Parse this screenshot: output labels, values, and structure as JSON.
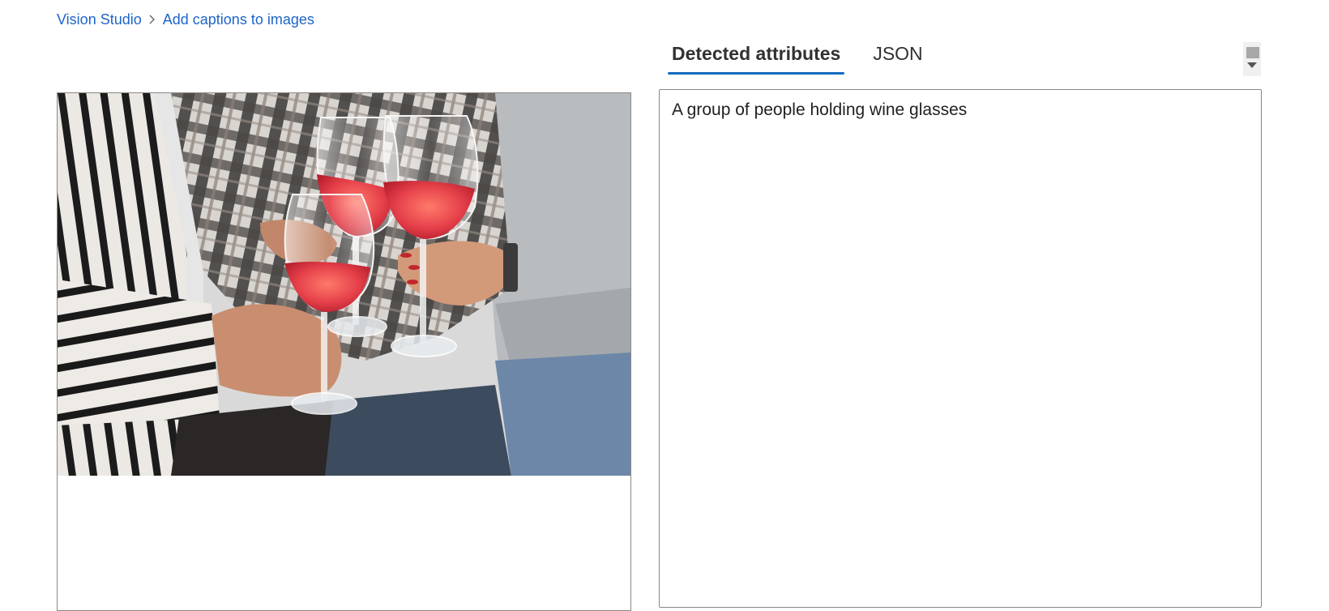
{
  "breadcrumb": {
    "items": [
      {
        "label": "Vision Studio"
      },
      {
        "label": "Add captions to images"
      }
    ],
    "separator_icon": "chevron-right-icon"
  },
  "image_panel": {
    "alt": "Photo: hands clinking glasses of rosé wine"
  },
  "tabs": [
    {
      "label": "Detected attributes",
      "active": true
    },
    {
      "label": "JSON",
      "active": false
    }
  ],
  "scroll_control": {
    "icon": "caret-down-icon"
  },
  "result": {
    "caption": "A group of people holding wine glasses"
  },
  "colors": {
    "link": "#1e64c8",
    "accent": "#0f6cbd",
    "border": "#8a8886",
    "text": "#201f1e"
  }
}
